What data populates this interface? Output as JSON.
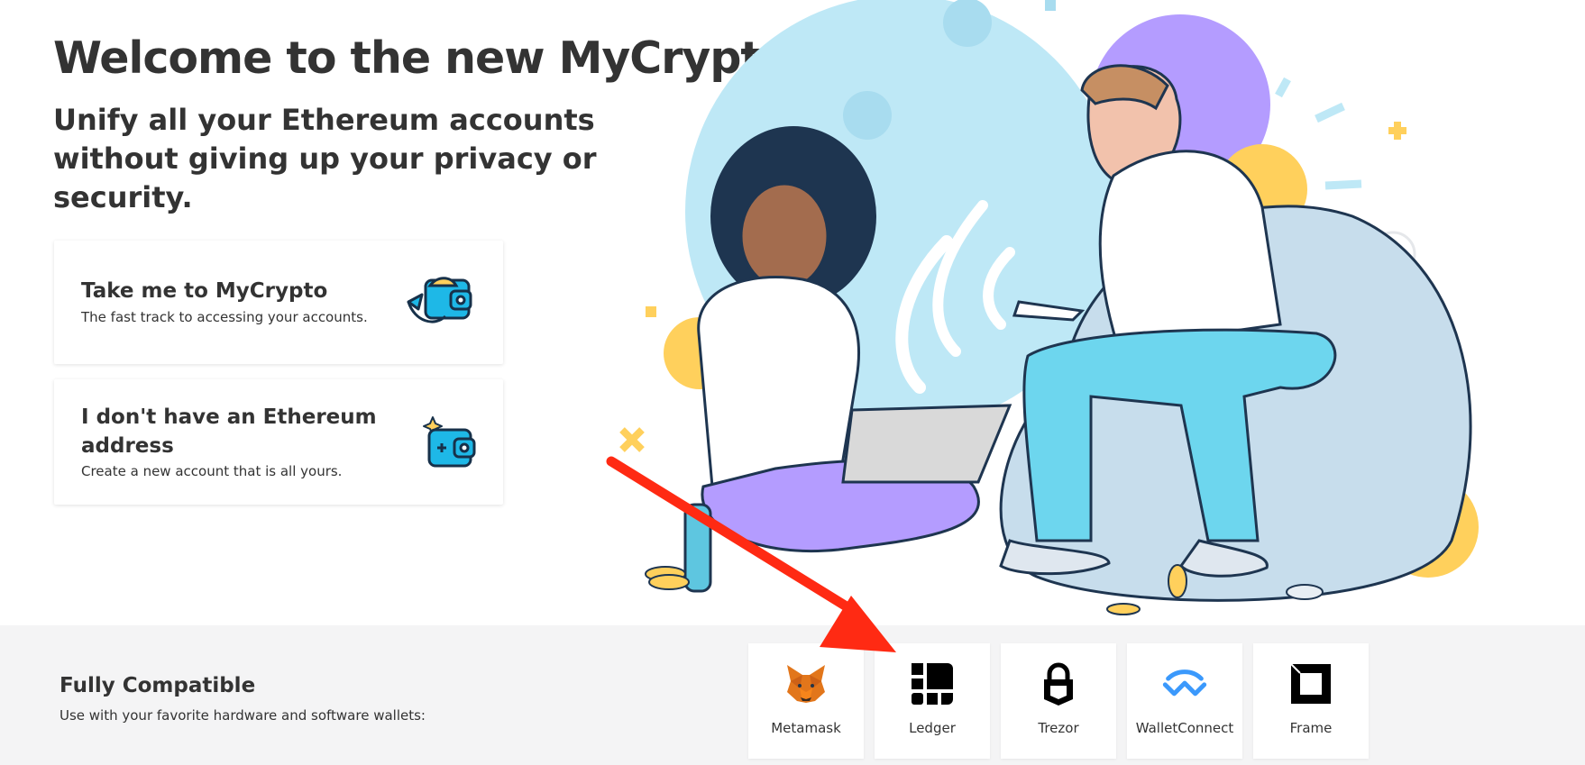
{
  "hero": {
    "title": "Welcome to the new MyCrypto",
    "subtitle_line1": "Unify all your Ethereum accounts",
    "subtitle_line2": "without giving up your privacy or security."
  },
  "actions": [
    {
      "title": "Take me to MyCrypto",
      "description": "The fast track to accessing your accounts.",
      "icon": "wallet-arrow-icon"
    },
    {
      "title": "I don't have an Ethereum address",
      "description": "Create a new account that is all yours.",
      "icon": "new-wallet-sparkle-icon"
    }
  ],
  "compat": {
    "title": "Fully Compatible",
    "description": "Use with your favorite hardware and software wallets:",
    "wallets": [
      {
        "label": "Metamask",
        "icon": "metamask-fox-icon"
      },
      {
        "label": "Ledger",
        "icon": "ledger-icon"
      },
      {
        "label": "Trezor",
        "icon": "trezor-lock-icon"
      },
      {
        "label": "WalletConnect",
        "icon": "walletconnect-icon"
      },
      {
        "label": "Frame",
        "icon": "frame-icon"
      }
    ]
  },
  "annotation": {
    "type": "red-arrow",
    "points_to": "Ledger",
    "color": "#ff2a13"
  },
  "colors": {
    "accent_blue": "#1eb8e7",
    "illustration_light_blue": "#bee8f6",
    "purple": "#b49cff",
    "yellow": "#ffd05c",
    "band_bg": "#f4f4f5",
    "text_dark": "#333333"
  }
}
